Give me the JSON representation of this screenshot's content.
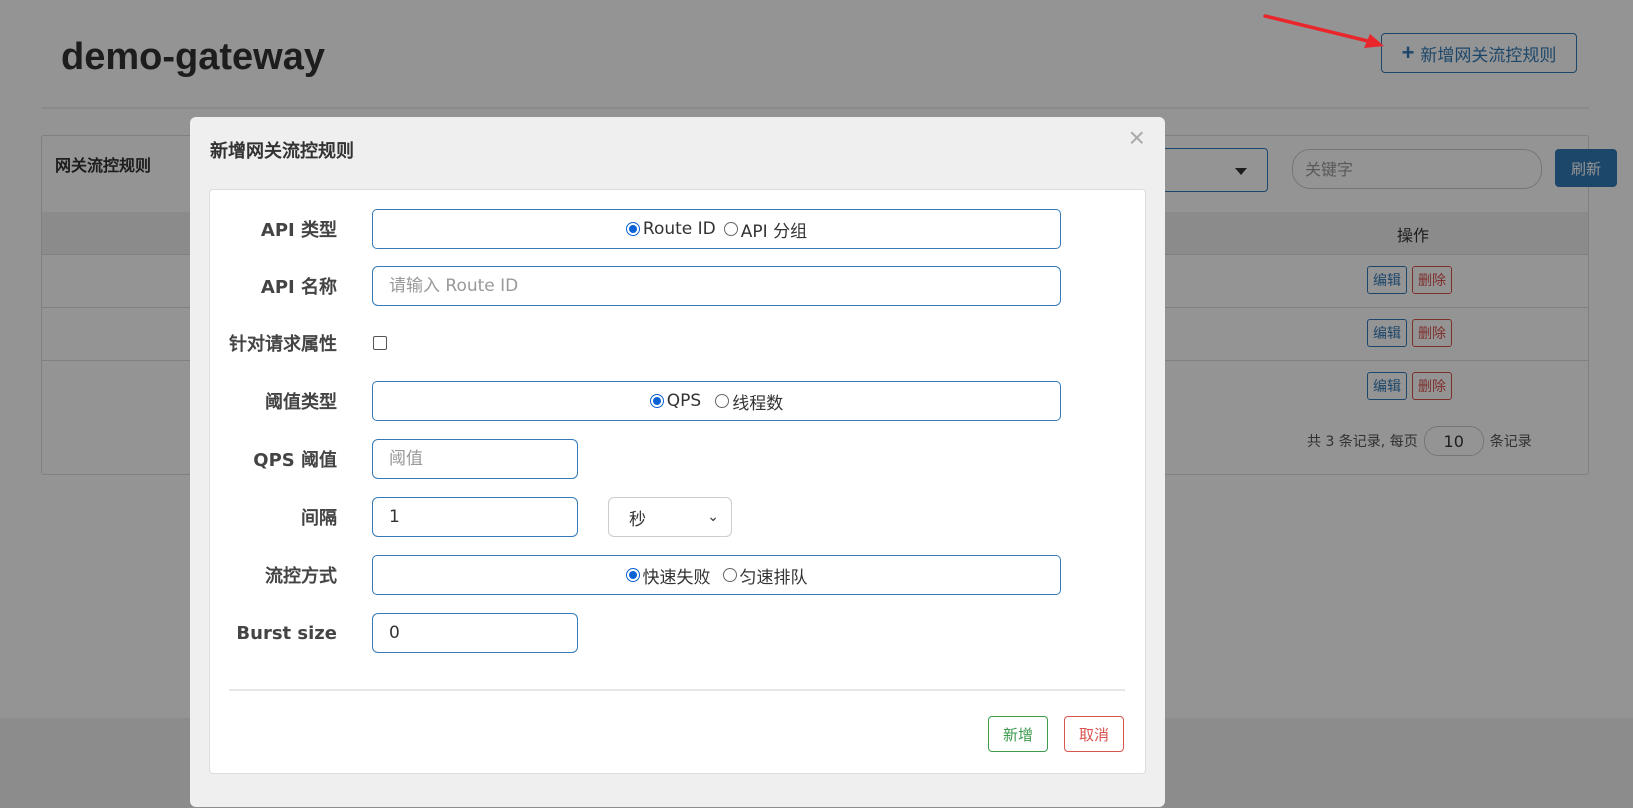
{
  "app": {
    "title": "demo-gateway",
    "add_rule_button": "新增网关流控规则",
    "add_icon": "plus-icon"
  },
  "panel": {
    "title": "网关流控规则",
    "keyword_placeholder": "关键字",
    "refresh_label": "刷新",
    "operation_header": "操作",
    "rows": [
      {
        "edit": "编辑",
        "delete": "删除"
      },
      {
        "edit": "编辑",
        "delete": "删除"
      },
      {
        "edit": "编辑",
        "delete": "删除"
      }
    ],
    "pager": {
      "prefix": "共 3 条记录, 每页",
      "page_size": "10",
      "suffix": "条记录"
    }
  },
  "modal": {
    "title": "新增网关流控规则",
    "close_label": "×",
    "api_type": {
      "label": "API 类型",
      "options": [
        "Route ID",
        "API 分组"
      ],
      "selected": "Route ID"
    },
    "api_name": {
      "label": "API 名称",
      "placeholder": "请输入 Route ID",
      "value": ""
    },
    "request_attr": {
      "label": "针对请求属性",
      "checked": false
    },
    "threshold_type": {
      "label": "阈值类型",
      "options": [
        "QPS",
        "线程数"
      ],
      "selected": "QPS"
    },
    "qps_threshold": {
      "label": "QPS 阈值",
      "placeholder": "阈值",
      "value": ""
    },
    "interval": {
      "label": "间隔",
      "value": "1",
      "unit": "秒"
    },
    "control_behavior": {
      "label": "流控方式",
      "options": [
        "快速失败",
        "匀速排队"
      ],
      "selected": "快速失败"
    },
    "burst_size": {
      "label": "Burst size",
      "value": "0"
    },
    "submit_label": "新增",
    "cancel_label": "取消"
  },
  "colors": {
    "primary": "#337ab7",
    "danger": "#d9534f",
    "success": "#3c9a4c",
    "annotation_arrow": "#e8262b"
  }
}
